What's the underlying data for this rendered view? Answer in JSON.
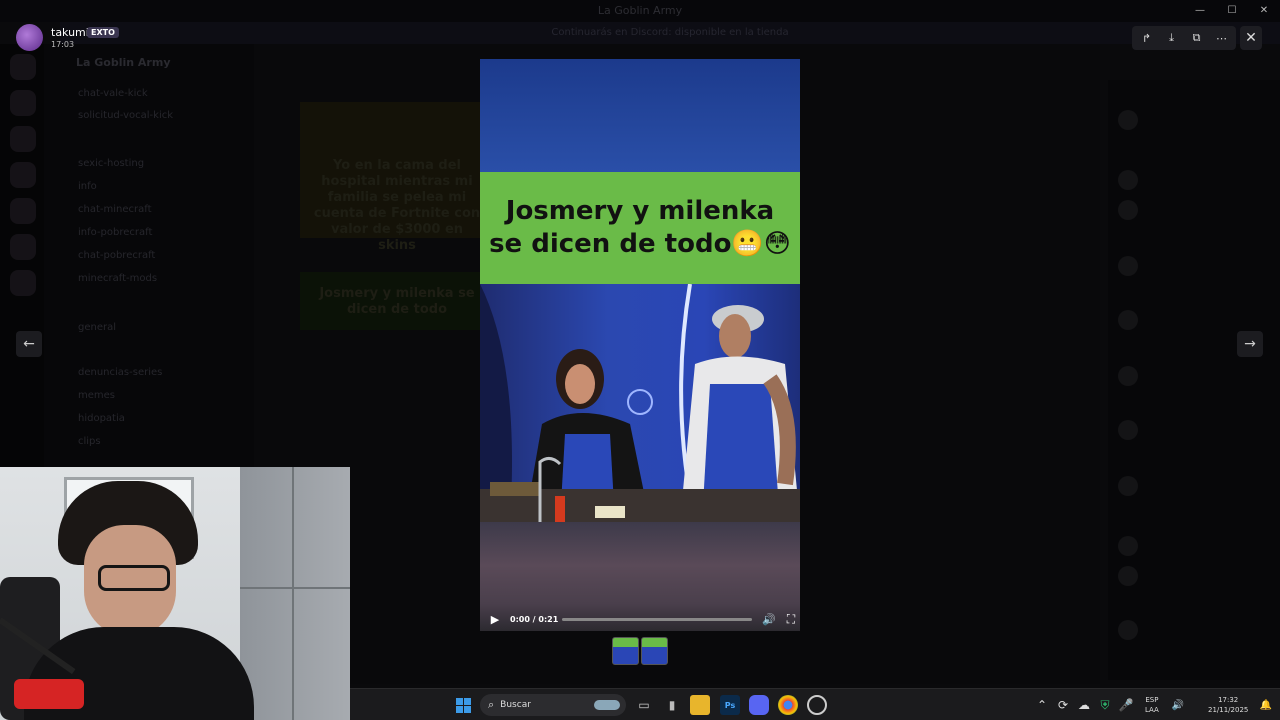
{
  "window": {
    "title": "La Goblin Army",
    "banner": "Continuarás en Discord: disponible en la tienda",
    "controls": [
      "—",
      "☐",
      "✕"
    ]
  },
  "background": {
    "guild_name": "La Goblin Army",
    "channels": [
      "chat-vale-kick",
      "solicitud-vocal-kick",
      "sexic-hosting",
      "info",
      "chat-minecraft",
      "info-pobrecraft",
      "chat-pobrecraft",
      "minecraft-mods",
      "general",
      "denuncias-series",
      "memes",
      "hidopatia",
      "clips"
    ],
    "message_text": "Yo en la cama del hospital mientras mi familia se pelea mi cuenta de Fortnite con valor de $3000 en skins",
    "message_text2": "Josmery y milenka se dicen de todo"
  },
  "viewer": {
    "username": "takumi",
    "user_tag": "EXTO",
    "timestamp": "17:03",
    "actions": [
      {
        "name": "forward-icon",
        "glyph": "↱"
      },
      {
        "name": "download-icon",
        "glyph": "⤓"
      },
      {
        "name": "open-external-icon",
        "glyph": "⧉"
      },
      {
        "name": "more-icon",
        "glyph": "⋯"
      }
    ],
    "close_glyph": "✕",
    "prev_glyph": "←",
    "next_glyph": "→"
  },
  "video": {
    "caption": "Josmery y milenka se dicen de todo😬😳",
    "time_display": "0:00 / 0:21",
    "progress": 0,
    "play_glyph": "▶",
    "volume_glyph": "🔊",
    "fullscreen_glyph": "⛶"
  },
  "taskbar": {
    "search_label": "Buscar",
    "lang_line1": "ESP",
    "lang_line2": "LAA",
    "time": "17:32",
    "date": "21/11/2025",
    "tray_glyphs": [
      "⌃",
      "☁",
      "🎤",
      "🔊",
      "🔔"
    ]
  }
}
